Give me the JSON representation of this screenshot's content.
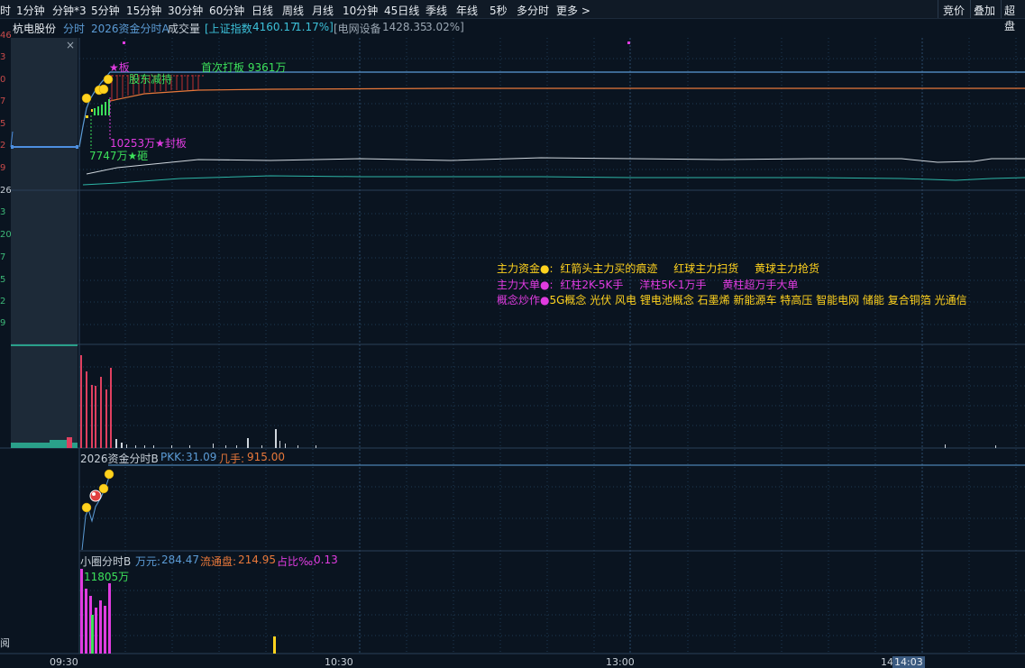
{
  "toolbar": {
    "first_partial": "时",
    "tabs": [
      "1分钟",
      "分钟*3",
      "5分钟",
      "15分钟",
      "30分钟",
      "60分钟",
      "日线",
      "周线",
      "月线",
      "10分钟",
      "45日线",
      "季线",
      "年线",
      "5秒",
      "多分时",
      "更多 >"
    ],
    "right_buttons": [
      "竞价",
      "叠加",
      "超盘"
    ]
  },
  "info": {
    "stock_name": "杭电股份",
    "mode": "分时",
    "indicator": "2026资金分时A",
    "volume_label": "成交量",
    "index_name": "[上证指数",
    "index_value": "4160.17",
    "index_change": "1.17%]",
    "sector_name": "[电网设备",
    "sector_value": "1428.35",
    "sector_change": "3.02%]"
  },
  "left_axis": [
    "46",
    "3",
    "0",
    "7",
    "5",
    "2",
    "9",
    "26",
    "3",
    "20",
    "7",
    "5",
    "2",
    "9"
  ],
  "annotations": {
    "board_star": "★板",
    "first_limit": "首次打板 9361万",
    "shareholder": "股东减持",
    "seal_board": "10253万★封板",
    "smash": "7747万★砸"
  },
  "legend": {
    "line1_label": "主力资金●:",
    "line1_items": [
      "红箭头主力买的痕迹",
      "红球主力扫货",
      "黄球主力抢货"
    ],
    "line2_label": "主力大单●:",
    "line2_items": [
      "红柱2K-5K手",
      "洋柱5K-1万手",
      "黄柱超万手大单"
    ],
    "line3_label": "概念炒作●",
    "line3_text": "5G概念 光伏 风电 锂电池概念 石墨烯 新能源车 特高压 智能电网 储能 复合铜箔 光通信"
  },
  "panel2": {
    "title": "2026资金分时B",
    "pkk_label": "PKK:",
    "pkk_value": "31.09",
    "hand_label": "几手:",
    "hand_value": "915.00"
  },
  "panel3": {
    "title": "小圈分时B",
    "wan_label": "万元:",
    "wan_value": "284.47",
    "float_label": "流通盘:",
    "float_value": "214.95",
    "ratio_label": "占比‰:",
    "ratio_value": "0.13",
    "bar_label": "11805万"
  },
  "xaxis": [
    "09:30",
    "10:30",
    "13:00",
    "14",
    "14:03"
  ],
  "bottom_left": "阅",
  "colors": {
    "price_line": "#5b9bd5",
    "avg_line": "#e8783a",
    "white_line": "#cfd6dd",
    "teal_line": "#2db5a6",
    "up_red": "#e04040",
    "magenta": "#e03ce0",
    "yellow": "#ffd21e",
    "green": "#3ce05a"
  }
}
